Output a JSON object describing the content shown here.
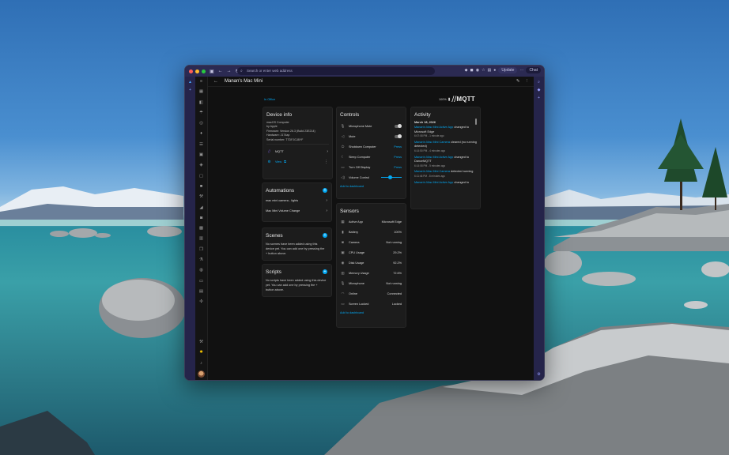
{
  "browser": {
    "address_placeholder": "Search or enter web address",
    "update_label": "Update",
    "chat_label": "Chat"
  },
  "header": {
    "title": "Manan's Mac Mini"
  },
  "breadcrumb": "In Office",
  "mqtt": {
    "battery": "100%",
    "logo": "MQTT"
  },
  "device_info": {
    "title": "Device info",
    "model": "macOS Computer",
    "by": "by Apple",
    "firmware": "Firmware: Version 26.3 (Build 23E214)",
    "hardware": "Hardware: J174ap",
    "serial": "Serial number: T7DFJGJ8YF",
    "integration": "MQTT",
    "view_label": "View"
  },
  "automations": {
    "title": "Automations",
    "items": [
      "mac mini camera - lights",
      "Mac Mini Volume Change"
    ]
  },
  "scenes": {
    "title": "Scenes",
    "note": "No scenes have been added using this device yet. You can add one by pressing the + button above."
  },
  "scripts": {
    "title": "Scripts",
    "note": "No scripts have been added using this device yet. You can add one by pressing the + button above."
  },
  "controls": {
    "title": "Controls",
    "items": [
      {
        "label": "Microphone Mute",
        "icon": "mic-icon",
        "kind": "toggle"
      },
      {
        "label": "Mute",
        "icon": "speaker-icon",
        "kind": "toggle"
      },
      {
        "label": "Shutdown Computer",
        "icon": "power-icon",
        "kind": "press",
        "action": "Press"
      },
      {
        "label": "Sleep Computer",
        "icon": "sleep-icon",
        "kind": "press",
        "action": "Press"
      },
      {
        "label": "Turn Off Display",
        "icon": "display-icon",
        "kind": "press",
        "action": "Press"
      },
      {
        "label": "Volume Control",
        "icon": "volume-icon",
        "kind": "slider"
      }
    ],
    "add_label": "Add to dashboard"
  },
  "sensors": {
    "title": "Sensors",
    "items": [
      {
        "label": "Active App",
        "value": "Microsoft Edge"
      },
      {
        "label": "Battery",
        "value": "100%"
      },
      {
        "label": "Camera",
        "value": "Not running"
      },
      {
        "label": "CPU Usage",
        "value": "29.2%"
      },
      {
        "label": "Disk Usage",
        "value": "92.2%"
      },
      {
        "label": "Memory Usage",
        "value": "72.6%"
      },
      {
        "label": "Microphone",
        "value": "Not running"
      },
      {
        "label": "Online",
        "value": "Connected"
      },
      {
        "label": "Screen Locked",
        "value": "Locked"
      }
    ],
    "add_label": "Add to dashboard"
  },
  "activity": {
    "title": "Activity",
    "date": "March 18, 2026",
    "items": [
      {
        "link": "Manan's Mac Mini Active App",
        "text": " changed to Microsoft Edge",
        "time": "6:07:08 PM - 1 minute ago"
      },
      {
        "link": "Manan's Mac Mini Camera",
        "text": " cleared (no running detected)",
        "time": "6:14:50 PM - 4 minutes ago"
      },
      {
        "link": "Manan's Mac Mini Active App",
        "text": " changed to DanceMQTT",
        "time": "6:14:08 PM - 5 minutes ago"
      },
      {
        "link": "Manan's Mac Mini Camera",
        "text": " detected running",
        "time": "6:11:46 PM - 8 minutes ago"
      },
      {
        "link": "Manan's Mac Mini Active App",
        "text": " changed to",
        "time": ""
      }
    ]
  }
}
